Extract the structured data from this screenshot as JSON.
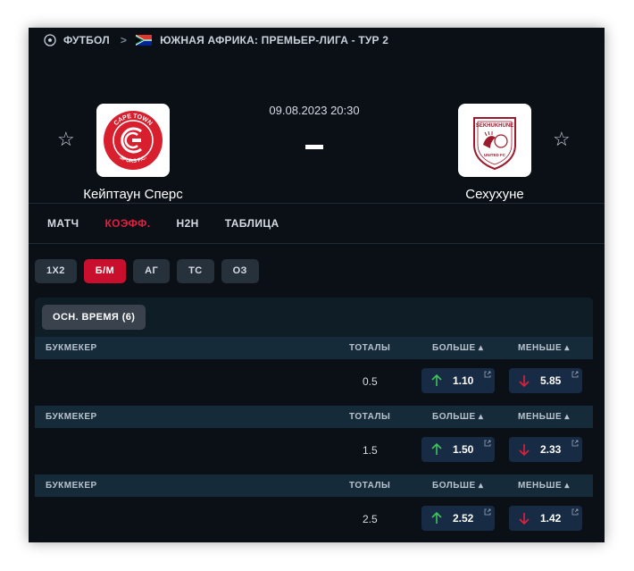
{
  "breadcrumb": {
    "sport": "ФУТБОЛ",
    "league": "ЮЖНАЯ АФРИКА: ПРЕМЬЕР-ЛИГА - ТУР 2"
  },
  "match": {
    "datetime": "09.08.2023 20:30",
    "score": "-",
    "home": {
      "name": "Кейптаун Сперс",
      "logo_text_top": "CAPE TOWN",
      "logo_text_bottom": "SPURS F.C."
    },
    "away": {
      "name": "Сехухуне",
      "logo_text_top": "SEKHUKHUNE",
      "logo_text_bottom": "UNITED FC"
    }
  },
  "tabs": [
    {
      "label": "МАТЧ",
      "active": false
    },
    {
      "label": "КОЭФФ.",
      "active": true
    },
    {
      "label": "H2H",
      "active": false
    },
    {
      "label": "ТАБЛИЦА",
      "active": false
    }
  ],
  "subtabs": [
    {
      "label": "1X2",
      "active": false
    },
    {
      "label": "Б/М",
      "active": true
    },
    {
      "label": "АГ",
      "active": false
    },
    {
      "label": "ТС",
      "active": false
    },
    {
      "label": "ОЗ",
      "active": false
    }
  ],
  "period_button": "ОСН. ВРЕМЯ (6)",
  "table_header": {
    "bookmaker": "БУКМЕКЕР",
    "totals": "ТОТАЛЫ",
    "over": "БОЛЬШЕ ▴",
    "under": "МЕНЬШЕ ▴"
  },
  "rows": [
    {
      "total": "0.5",
      "over": "1.10",
      "under": "5.85"
    },
    {
      "total": "1.5",
      "over": "1.50",
      "under": "2.33"
    },
    {
      "total": "2.5",
      "over": "2.52",
      "under": "1.42"
    }
  ],
  "colors": {
    "accent": "#c8102e",
    "accent_text": "#e0203f",
    "up_arrow": "#3fc35c",
    "down_arrow": "#e0203f",
    "panel_bg": "#0b1016",
    "odds_btn_bg": "#172b44"
  },
  "icons": {
    "sport": "soccer-ball-icon",
    "flag": "south-africa-flag-icon",
    "favorite": "star-outline-icon",
    "over": "arrow-up-icon",
    "under": "arrow-down-icon",
    "external": "external-link-icon"
  }
}
